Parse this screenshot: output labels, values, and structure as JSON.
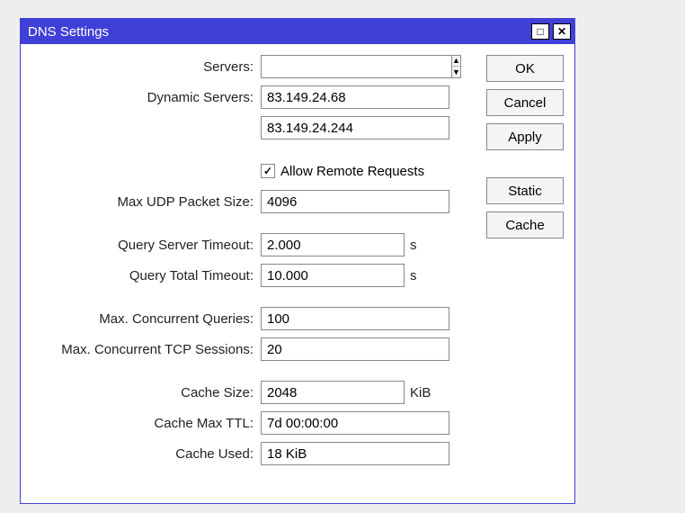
{
  "window": {
    "title": "DNS Settings"
  },
  "buttons": {
    "ok": "OK",
    "cancel": "Cancel",
    "apply": "Apply",
    "static": "Static",
    "cache": "Cache"
  },
  "labels": {
    "servers": "Servers:",
    "dynamic_servers": "Dynamic Servers:",
    "allow_remote": "Allow Remote Requests",
    "max_udp": "Max UDP Packet Size:",
    "query_server_timeout": "Query Server Timeout:",
    "query_total_timeout": "Query Total Timeout:",
    "max_conc_queries": "Max. Concurrent Queries:",
    "max_conc_tcp": "Max. Concurrent TCP Sessions:",
    "cache_size": "Cache Size:",
    "cache_max_ttl": "Cache Max TTL:",
    "cache_used": "Cache Used:"
  },
  "values": {
    "servers": "",
    "dyn1": "83.149.24.68",
    "dyn2": "83.149.24.244",
    "max_udp": "4096",
    "query_server_timeout": "2.000",
    "query_total_timeout": "10.000",
    "max_conc_queries": "100",
    "max_conc_tcp": "20",
    "cache_size": "2048",
    "cache_max_ttl": "7d 00:00:00",
    "cache_used": "18 KiB"
  },
  "units": {
    "s": "s",
    "kib": "KiB"
  }
}
